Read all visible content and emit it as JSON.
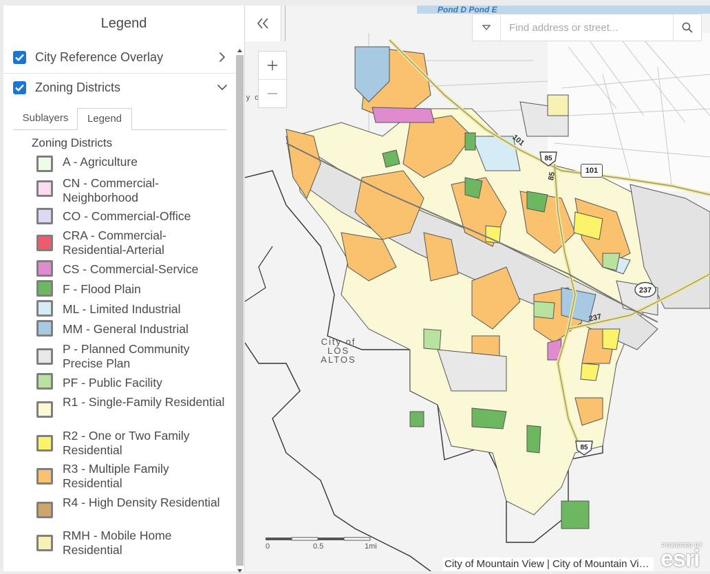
{
  "panel": {
    "title": "Legend",
    "layers": [
      {
        "label": "City Reference Overlay",
        "checked": true,
        "expanded": false
      },
      {
        "label": "Zoning Districts",
        "checked": true,
        "expanded": true
      }
    ],
    "tabs": [
      {
        "label": "Sublayers",
        "active": false
      },
      {
        "label": "Legend",
        "active": true
      }
    ],
    "legend_heading": "Zoning Districts",
    "legend_items": [
      {
        "label": "A - Agriculture",
        "color": "#eefbe6"
      },
      {
        "label": "CN - Commercial-Neighborhood",
        "color": "#fbdcf0"
      },
      {
        "label": "CO - Commercial-Office",
        "color": "#dcd9f7"
      },
      {
        "label": "CRA - Commercial-Residential-Arterial",
        "color": "#f05a6c"
      },
      {
        "label": "CS - Commercial-Service",
        "color": "#e08ad0"
      },
      {
        "label": "F - Flood Plain",
        "color": "#6db760"
      },
      {
        "label": "ML - Limited Industrial",
        "color": "#d5ecf6"
      },
      {
        "label": "MM - General Industrial",
        "color": "#a8c9e2"
      },
      {
        "label": "P - Planned Community Precise Plan",
        "color": "#e8e8e8"
      },
      {
        "label": "PF - Public Facility",
        "color": "#b8e29d"
      },
      {
        "label": "R1 - Single-Family Residential",
        "color": "#fbf8d6"
      },
      {
        "label": "R2 - One or Two Family Residential",
        "color": "#fbf46b"
      },
      {
        "label": "R3 - Multiple Family Residential",
        "color": "#fac26e"
      },
      {
        "label": "R4 - High Density Residential",
        "color": "#cfa56b"
      },
      {
        "label": "RMH - Mobile Home Residential",
        "color": "#f7f2b4"
      }
    ]
  },
  "map": {
    "search_placeholder": "Find address or street...",
    "labels": {
      "city_los_altos": "City of LOS ALTOS",
      "top_left_fragment": "y o ALT",
      "ponds": "Pond D  Pond E",
      "scale_0": "0",
      "scale_half": "0.5",
      "scale_1": "1mi",
      "routes": [
        "101",
        "85",
        "101",
        "85",
        "237",
        "237",
        "85"
      ]
    },
    "attribution": "City of Mountain View | City of Mountain View GIS",
    "esri_powered": "POWERED BY",
    "esri_name": "esri"
  }
}
